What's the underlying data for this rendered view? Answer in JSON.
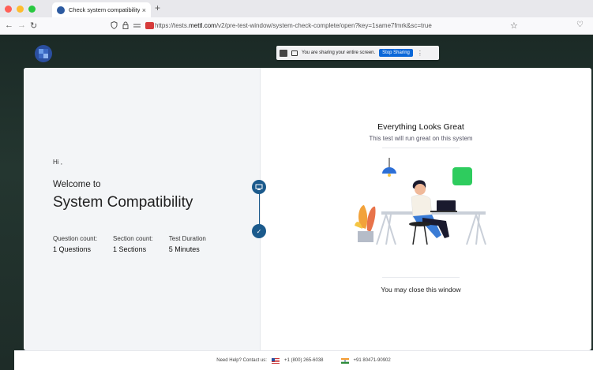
{
  "browser": {
    "tab_title": "Check system compatibility and",
    "tab_close": "×",
    "new_tab": "+",
    "url_domain_prefix": "https://tests.",
    "url_domain": "mettl.com",
    "url_path": "/v2/pre-test-window/system-check-complete/open?key=1same7fmrk&sc=true",
    "back": "←",
    "forward": "→",
    "reload": "↻",
    "star": "☆",
    "pocket": "♡"
  },
  "share_bar": {
    "message": "You are sharing your entire screen.",
    "stop_label": "Stop Sharing",
    "grip": "⋮"
  },
  "left_panel": {
    "greeting": "Hi ,",
    "welcome": "Welcome to",
    "title": "System Compatibility",
    "stats": [
      {
        "label": "Question count:",
        "value": "1 Questions"
      },
      {
        "label": "Section count:",
        "value": "1 Sections"
      },
      {
        "label": "Test Duration",
        "value": "5  Minutes"
      }
    ]
  },
  "steps": {
    "check": "✓"
  },
  "right_panel": {
    "title": "Everything Looks Great",
    "subtitle": "This test will run great on this system",
    "close_message": "You may close this window"
  },
  "footer": {
    "help": "Need Help? Contact us:",
    "phone_us": "+1 (800) 265-6038",
    "phone_in": "+91 80471-90902"
  },
  "colors": {
    "accent": "#1b5a8c",
    "stop_button": "#0a67d8",
    "tile_green": "#2ecc5e",
    "lamp_blue": "#2d6fd6"
  }
}
